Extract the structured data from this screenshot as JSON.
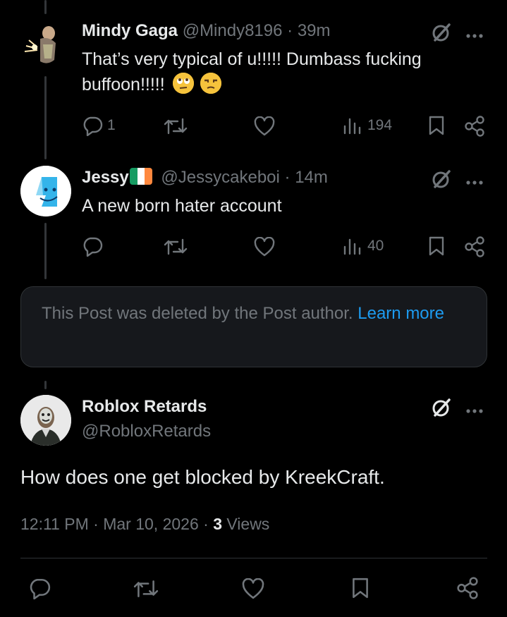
{
  "reply1": {
    "name": "Mindy Gaga",
    "handle": "@Mindy8196",
    "sep": "·",
    "time": "39m",
    "text": "That’s very typical of u!!!!! Dumbass fucking buffoon!!!!!",
    "emojis": [
      "face-with-rolling-eyes",
      "unamused-face"
    ],
    "replies": "1",
    "views": "194"
  },
  "reply2": {
    "name": "Jessy",
    "flag": "ireland-flag",
    "handle": "@Jessycakeboi",
    "sep": "·",
    "time": "14m",
    "text": "A new born hater account",
    "replies": "",
    "views": "40"
  },
  "deleted": {
    "text": "This Post was deleted by the Post author.",
    "link": "Learn more"
  },
  "main": {
    "name": "Roblox Retards",
    "handle": "@RobloxRetards",
    "text": "How does one get blocked by KreekCraft.",
    "time": "12:11 PM",
    "sep1": "·",
    "date": "Mar 10, 2026",
    "sep2": "·",
    "views_count": "3",
    "views_label": "Views"
  },
  "colors": {
    "background": "#000000",
    "text": "#e7e9ea",
    "muted": "#71767b",
    "link": "#1d9bf0",
    "ireland_green": "#169b62",
    "ireland_orange": "#ff883e"
  }
}
